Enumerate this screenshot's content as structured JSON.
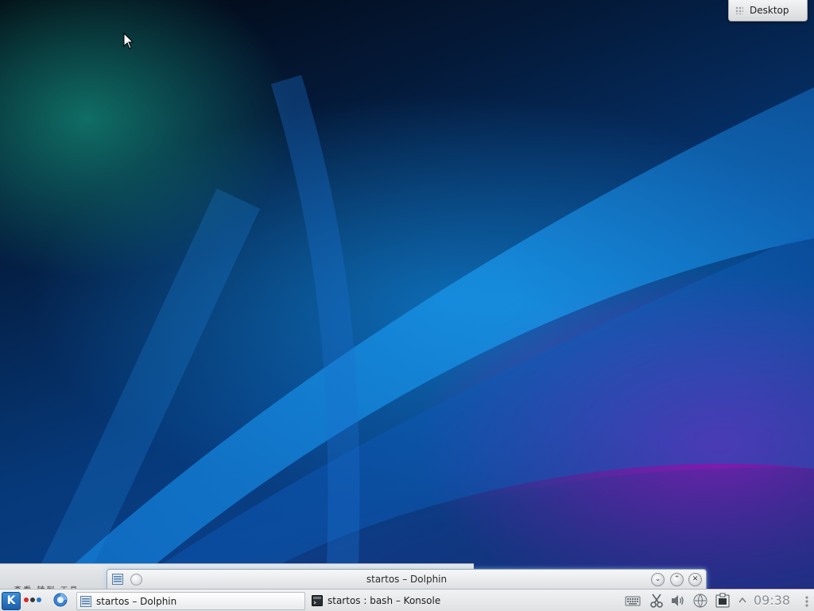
{
  "desktop": {
    "activity_label": "Desktop"
  },
  "dolphin_window": {
    "title": "startos – Dolphin",
    "menu_fragment": "… 查看  转到  工具"
  },
  "panel": {
    "launcher_label": "K",
    "tasks": [
      {
        "label": "startos – Dolphin",
        "icon": "folder-icon",
        "active": true
      },
      {
        "label": "startos : bash – Konsole",
        "icon": "terminal-icon",
        "active": false
      }
    ],
    "tray": [
      {
        "name": "keyboard-icon"
      },
      {
        "name": "clipboard-scissors-icon"
      },
      {
        "name": "volume-icon"
      },
      {
        "name": "network-icon"
      },
      {
        "name": "printer-icon"
      },
      {
        "name": "tray-expand-icon"
      }
    ],
    "clock": "09:38"
  },
  "colors": {
    "accent": "#2a74c7",
    "activity_dots": [
      "#d62b2b",
      "#333a40",
      "#2a78c8"
    ]
  }
}
